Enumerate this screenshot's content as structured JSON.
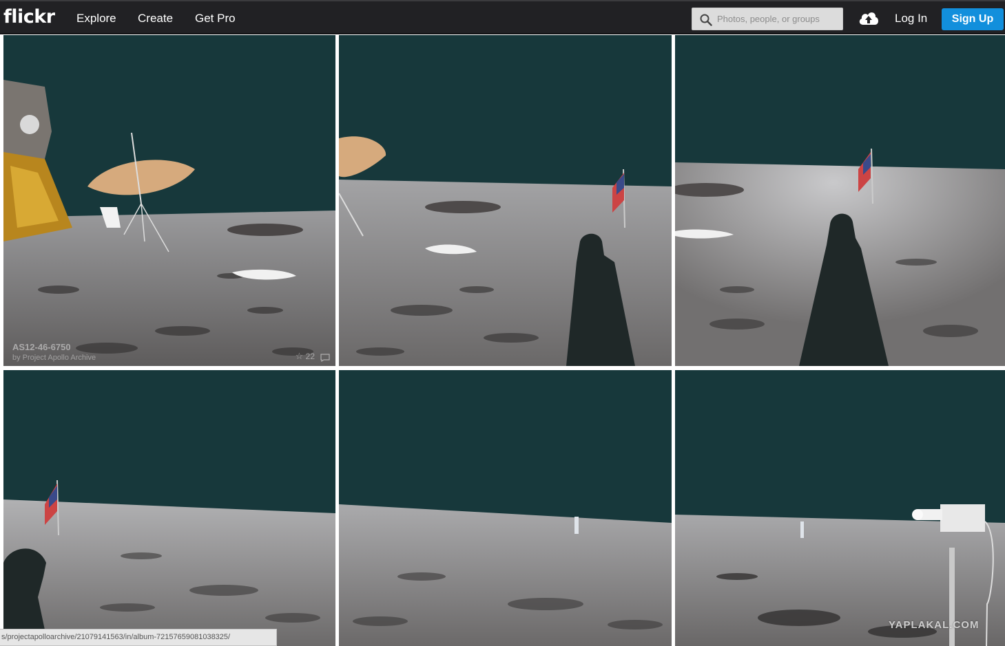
{
  "header": {
    "logo": "flickr",
    "nav": [
      "Explore",
      "Create",
      "Get Pro"
    ],
    "search_placeholder": "Photos, people, or groups",
    "login": "Log In",
    "signup": "Sign Up",
    "signup_color": "#128fdc",
    "bar_color": "#212124"
  },
  "photos": [
    {
      "id": "photo-1",
      "title": "AS12-46-6750",
      "author": "by Project Apollo Archive",
      "favorites": "22",
      "alt": "lunar module, umbrella antenna and flag"
    },
    {
      "id": "photo-2",
      "alt": "flag and shadow of astronaut"
    },
    {
      "id": "photo-3",
      "alt": "flag and long astronaut shadow"
    },
    {
      "id": "photo-4",
      "alt": "flag on horizon with shadow"
    },
    {
      "id": "photo-5",
      "alt": "lunar horizon with instrument"
    },
    {
      "id": "photo-6",
      "alt": "camera on tripod at horizon"
    }
  ],
  "status_bar_url": "s/projectapolloarchive/21079141563/in/album-72157659081038325/",
  "watermark": "YAPLAKAL.COM",
  "icons": {
    "search": "search-icon",
    "upload": "cloud-upload-icon",
    "favorite": "star-icon",
    "comment": "comment-icon"
  }
}
